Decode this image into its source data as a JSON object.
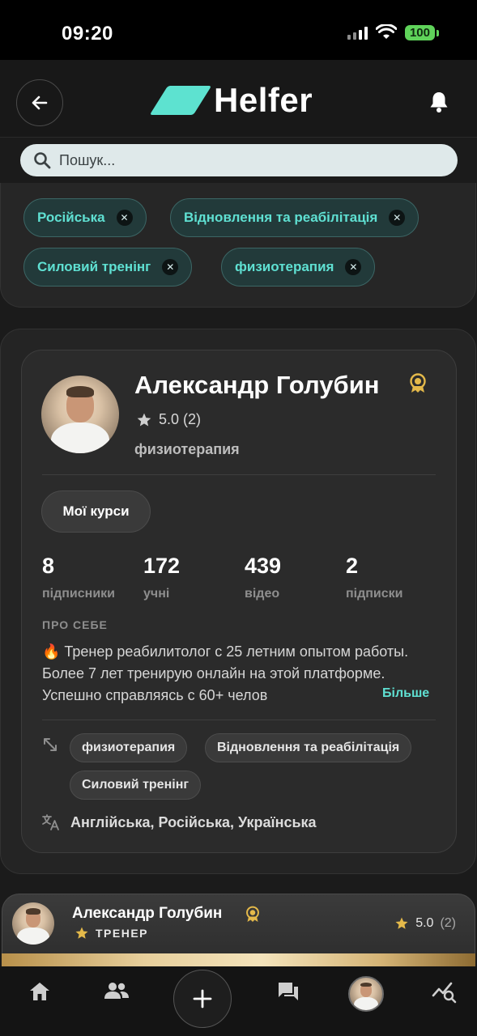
{
  "status_bar": {
    "time": "09:20",
    "battery": "100"
  },
  "header": {
    "app_name": "Helfer"
  },
  "search": {
    "placeholder": "Пошук..."
  },
  "filters": [
    {
      "label": "Російська"
    },
    {
      "label": "Відновлення та реабілітація"
    },
    {
      "label": "Силовий тренінг"
    },
    {
      "label": "физиотерапия"
    }
  ],
  "profile": {
    "name": "Александр Голубин",
    "rating": "5.0 (2)",
    "specialty": "физиотерапия",
    "courses_button": "Мої курси",
    "stats": [
      {
        "value": "8",
        "label": "підписники"
      },
      {
        "value": "172",
        "label": "учні"
      },
      {
        "value": "439",
        "label": "відео"
      },
      {
        "value": "2",
        "label": "підписки"
      }
    ],
    "about_heading": "ПРО СЕБЕ",
    "about_text": "🔥 Тренер реабилитолог с 25 летним опытом работы. Более 7 лет тренирую онлайн на этой платформе. Успешно справляясь с 60+ челов",
    "more_link": "Більше",
    "tags": [
      "физиотерапия",
      "Відновлення та реабілітація",
      "Силовий тренінг"
    ],
    "languages": "Англійська, Російська, Українська"
  },
  "mini_bar": {
    "name": "Александр Голубин",
    "role": "ТРЕНЕР",
    "rating": "5.0",
    "rating_count": "(2)"
  },
  "colors": {
    "accent": "#5fe0d2",
    "logo": "#5de2d0",
    "gold": "#e4b94a",
    "background": "#1b1b1b"
  },
  "icons": {
    "back": "arrow-left-icon",
    "notifications": "bell-icon",
    "search": "search-icon",
    "remove_filter": "close-icon",
    "verified": "award-badge-icon",
    "rating": "star-icon",
    "specialization": "arrows-diagonal-icon",
    "languages": "translate-icon",
    "nav": [
      "home-icon",
      "people-icon",
      "plus-icon",
      "chat-icon",
      "avatar",
      "analytics-search-icon"
    ]
  }
}
